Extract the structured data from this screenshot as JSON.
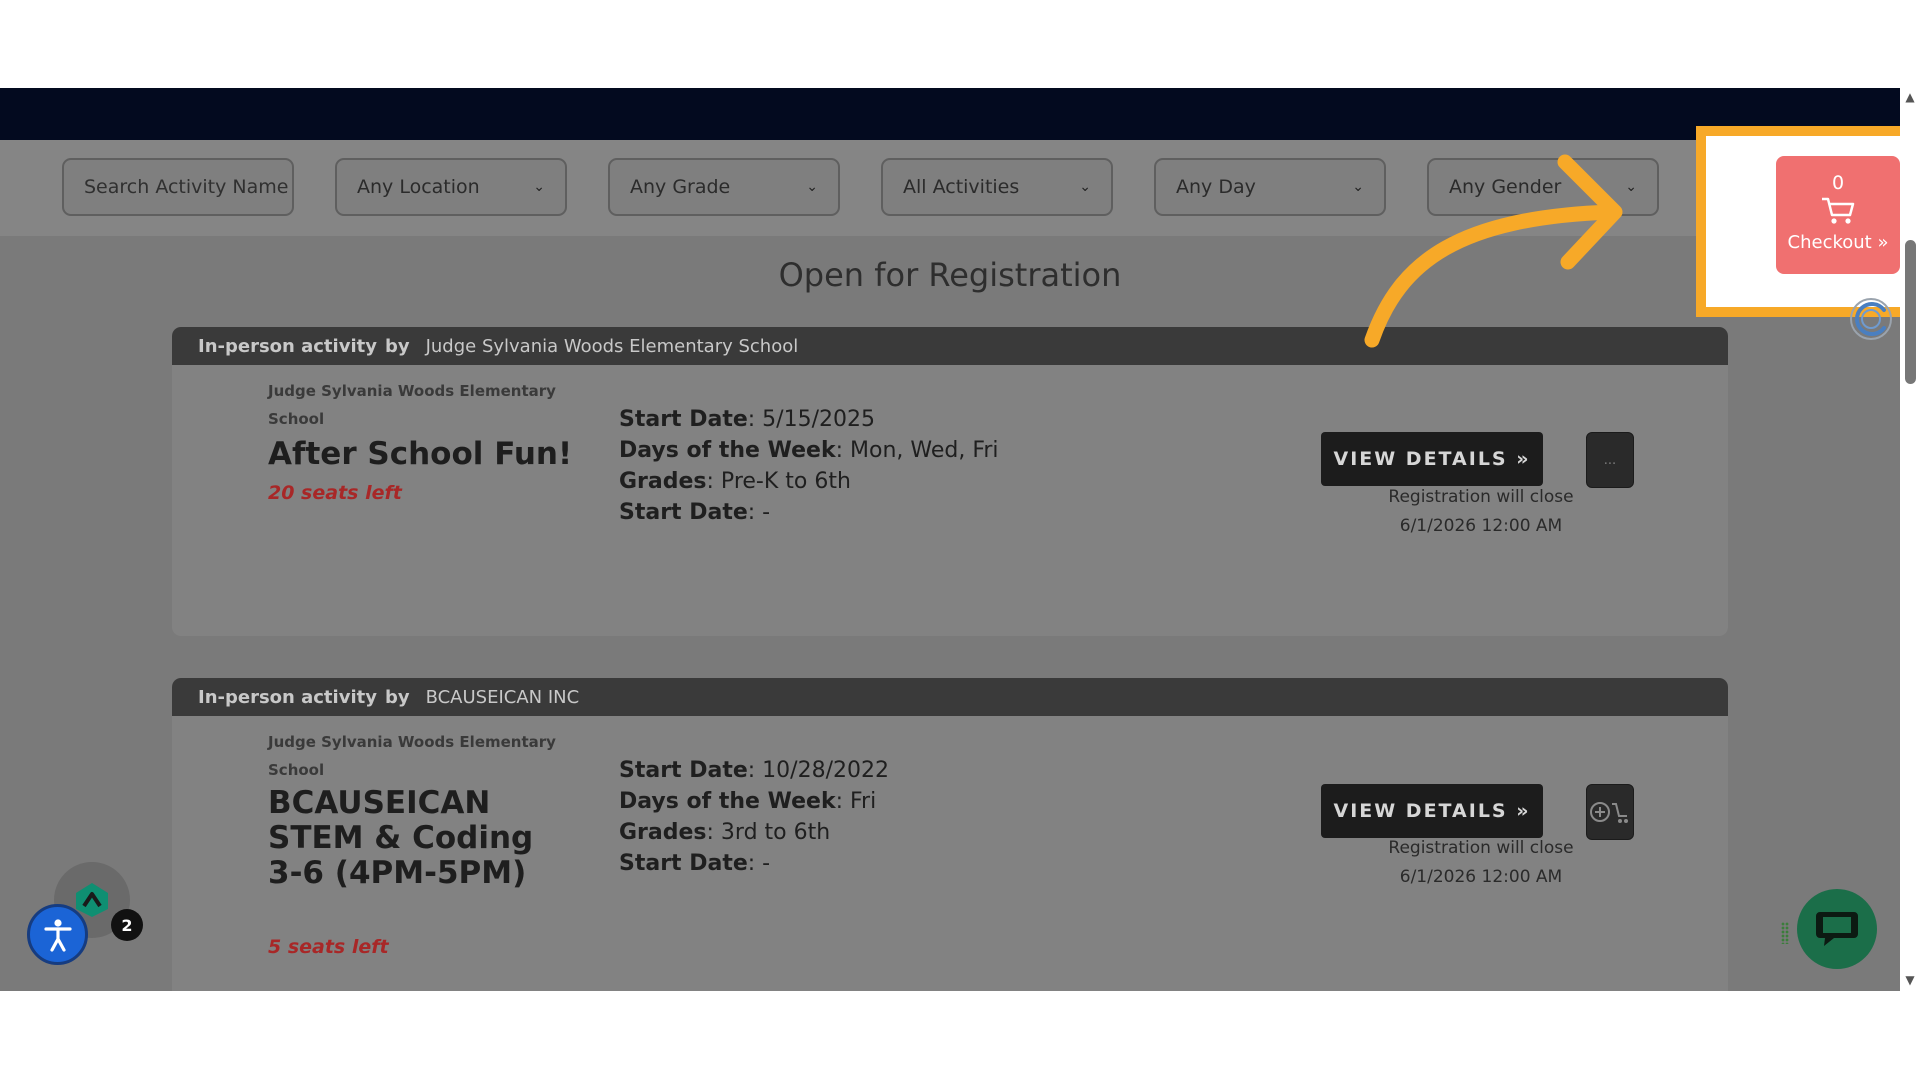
{
  "filters": {
    "search_placeholder": "Search Activity Name",
    "location": "Any Location",
    "grade": "Any Grade",
    "activities": "All Activities",
    "day": "Any Day",
    "gender": "Any Gender"
  },
  "heading": "Open for Registration",
  "cart": {
    "count": "0",
    "label": "Checkout »"
  },
  "cards": [
    {
      "type_label": "In-person activity",
      "by_label": "by",
      "org": "Judge Sylvania Woods Elementary School",
      "school": "Judge Sylvania Woods Elementary School",
      "title": "After School Fun!",
      "seats": "20 seats left",
      "start_date_label": "Start Date",
      "start_date": ": 5/15/2025",
      "days_label": "Days of the Week",
      "days": ": Mon, Wed, Fri",
      "grades_label": "Grades",
      "grades": ": Pre-K to 6th",
      "start_date2_label": "Start Date",
      "start_date2": ": -",
      "view_details": "VIEW DETAILS »",
      "reg_close_1": "Registration will close",
      "reg_close_2": "6/1/2026 12:00 AM",
      "cart_btn": "..."
    },
    {
      "type_label": "In-person activity",
      "by_label": "by",
      "org": "BCAUSEICAN INC",
      "school": "Judge Sylvania Woods Elementary School",
      "title": "BCAUSEICAN STEM & Coding 3-6 (4PM-5PM)",
      "seats": "5 seats left",
      "start_date_label": "Start Date",
      "start_date": ": 10/28/2022",
      "days_label": "Days of the Week",
      "days": ": Fri",
      "grades_label": "Grades",
      "grades": ": 3rd to 6th",
      "start_date2_label": "Start Date",
      "start_date2": ": -",
      "view_details": "VIEW DETAILS »",
      "reg_close_1": "Registration will close",
      "reg_close_2": "6/1/2026 12:00 AM"
    }
  ],
  "widgets": {
    "notification_count": "2"
  },
  "colors": {
    "accent_orange": "#f7a928",
    "checkout_red": "#f07070",
    "topbar": "#030a1f",
    "chat_green": "#1b6e49",
    "accessibility_blue": "#1b64d6"
  }
}
